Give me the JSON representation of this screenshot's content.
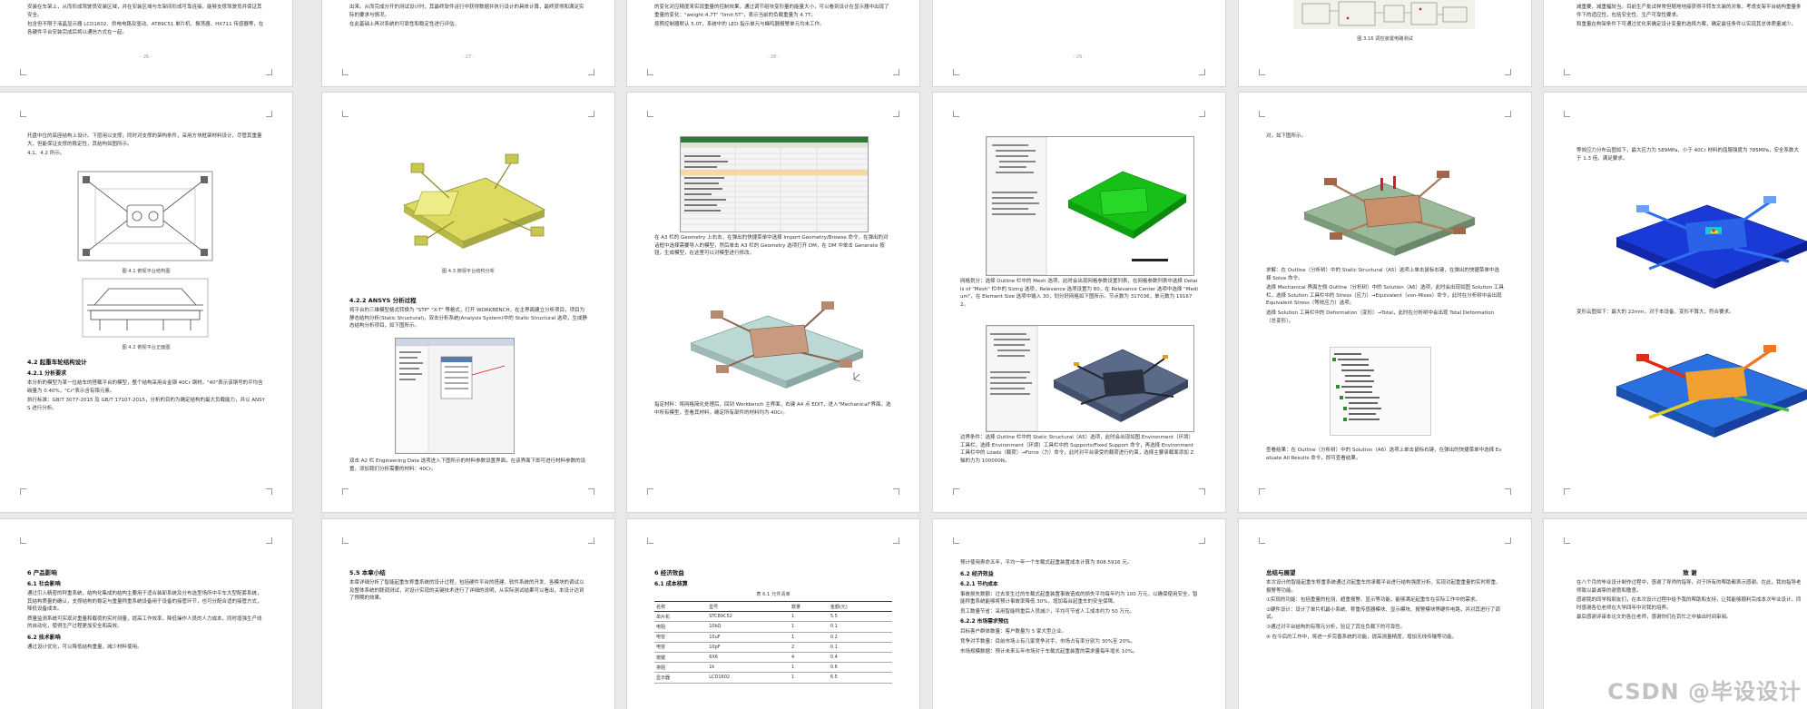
{
  "top_row": [
    {
      "page_number": "- 26 -",
      "lines": [
        "安装在车架上，从而形成驾驶员安装区域，并在安装区域与车架间形成可靠连接，能够支撑驾驶员并保证其安全。",
        "包含但不限于液晶显示器 LCD1602、供电电路及驱动、AT89C51 单片机、振荡器、HX711 传感器等，在各硬件平台安装完成后将以通信方式在一起。"
      ]
    },
    {
      "page_number": "- 27 -",
      "lines": [
        "出来。从而完成分开的测试设计时，其最终软件运行中获得数据并执行设计的具体计算，最终获得和满足实际的要求与情况。",
        "在此基础上再对系统的可靠性和稳定性进行评估。"
      ]
    },
    {
      "page_number": "- 28 -",
      "lines": [
        "的变化对应精度来实现重量的控制效果，通过调节组块变形量的能量大小，可以看到设计在显示器中出现了重量的变化：\"weight:4.7T\" \"limit:5T\"，表示当前的负载重量为 4.7T。",
        "按照控制器默认 5.0T，系统中的 LED 指示单元与蜂鸣器报警单元均未工作。"
      ]
    },
    {
      "page_number": "- 29 -",
      "lines": []
    },
    {
      "page_number": "",
      "lines": [],
      "caption": "图 3.16 调控装置电路测试"
    },
    {
      "page_number": "",
      "lines": [
        "减重要，减重幅较当。目前生产批试样常但随地地接获得平转车文装的对象，考虑支架平台结构重量条件下的适应性，包括安全性、生产可靠性要求。",
        "和重量在构架条件下可通过优化来确定设计变量的选择方案，确定最佳条件以实现其总体质量减少。"
      ]
    }
  ],
  "mid_row": [
    {
      "page_number": "- 30 -",
      "lines_top": [
        "托盘中位的底座结构上设计。下层用以支撑，同时对支撑的架构条件，采用方块框架材料设计，尽管其重量大，但能保证支撑的稳定性，其结构如图所示。",
        "4.1、4.2 所示。"
      ],
      "caption1": "图 4.1 俯视平台结构图",
      "caption2": "图 4.2 俯视平台正面图",
      "h1": "4.2 起重车轮结构设计",
      "h2": "4.2.1 分析要求",
      "lines_bottom": [
        "本分析的模型为某一位结车的搭载平台的模型，整个结构采用合金钢 40Cr 钢材。\"40\"表示该钢号的平均含碳量为 0.40%，\"Cr\"表示含有铬元素。",
        "执行标准：GB/T 3077-2015 及 GB/T 17107-2015，分析的目的为确定结构的最大负载能力，并以 ANSYS 进行分析。"
      ]
    },
    {
      "page_number": "- 31 -",
      "caption1": "图 4.3 俯视平台结构分析",
      "h1": "4.2.2 ANSYS 分析过程",
      "lines": [
        "将平台的三维模型格式转换为 \"STP\" \"X-T\" 等格式，打开 WORKBENCH，在主界面建立分析项目，项目为静态结构分析(Static Structural)，双击分析系统(Analysis System)中的 Static Structural 选项，生成静态结构分析项目，如下图所示。"
      ],
      "lines_bottom": [
        "双击 A2 栏 Engineering Data 选项进入下图所示的材料参数设置界面，在该界面下即可进行材料参数的设置，添加我们分析需要的材料：40Cr。"
      ]
    },
    {
      "page_number": "- 32 -",
      "lines": [
        "在 A3 栏的 Geometry 上右击，在弹出的快捷菜单中选择 Import Geometry/Browse 命令，在弹出的对话框中选择需要导入的模型，然后单击 A3 栏的 Geometry 选项打开 DM，在 DM 中单击 Generate 按钮，生成模型，在这里可以对模型进行修改。"
      ],
      "lines_bottom": [
        "指定材料：将网格简化处理后，回到 Workbench 主界面，右键 A4 点 EDIT，进入\"Mechanical\"界面。选中所有模型，查看其材料，确定所有部件的材料均为 40Cr。"
      ]
    },
    {
      "page_number": "- 33 -",
      "lines": [
        "网格划分：选择 Outline 栏中的 Mesh 选项，此时会出现网格参数设置列表，在网格参数列表中选择 Details of \"Mesh\" 栏中的 Sizing 选项，Relevance 选项设置为 80，在 Relevance Center 选项中选择 \"Medium\"，在 Element Size 选项中输入 30，划分好网格如下图所示。节点数为 317036，单元数为 191672。"
      ],
      "lines_bottom": [
        "边界条件：选择 Outline 栏中的 Static Structural（A5）选项，此时会出现如图 Environment（环境）工具栏，选择 Environment（环境）工具栏中的 Supports/Fixed Support 命令，再选择 Environment 工具栏中的 Loads（载荷）→Force（力）命令，此时对平台承受的载荷进行约束，选择主要承载面添加 Z 轴的力为 100000N。"
      ]
    },
    {
      "page_number": "- 34 -",
      "lines": [
        "对，如下图所示。"
      ],
      "lines_mid": [
        "求解：在 Outline（分析树）中的 Static Structural（A5）选项上单击鼠标右键，在弹出的快捷菜单中选择 Solve 命令。",
        "选择 Mechanical 界面左侧 Outline（分析树）中的 Solution（A6）选项，此时会出现如图 Solution 工具栏，选择 Solution 工具栏中的 Stress（应力）→Equivalent（von-Mises）命令，此时在分析树中会出现 Equivalent Stress（等效应力）选项。",
        "选择 Solution 工具栏中的 Deformation（变形）→Total，此时在分析树中会出现 Total Deformation（总变形）。"
      ],
      "lines_bottom": [
        "查看结果：在 Outline（分析树）中的 Solution（A6）选项上单击鼠标右键，在弹出的快捷菜单中选择 Evaluate All Results 命令，即可查看结果。"
      ]
    },
    {
      "page_number": "- 35 -",
      "lines": [
        "等效应力分布云图如下，最大应力为 589MPa，小于 40Cr 材料的屈服强度为 785MPa，安全系数大于 1.3 倍，满足要求。"
      ],
      "lines_mid": [
        "变形云图如下：最大的 22mm，对于本设备，变形不算大，符合要求。"
      ]
    }
  ],
  "bottom_row": [
    {
      "h1": "6 产品影响",
      "h2": "6.1 社会影响",
      "lines": [
        "通过引入精密的秤重系统，结构化集成的结构主要用于适合装卸系统及分布选型场所中平车大型配套系统，其结构质量的确认，支撑结构的稳定与重量称重系统设备用于设备的接管环节，也可分配合适的接管方式，降低设备成本。",
        "质量监测系统可实现对重量和载荷的实时测量，提高工作效率，降低操作人员的人力成本，同时增强生产线的自动化，使得生产过程更加安全和高效。"
      ],
      "h3": "6.2 技术影响",
      "lines_bottom": [
        "通过设计优化，可以降低结构重量，减少材料使用。"
      ]
    },
    {
      "h1": "5.5 本章小结",
      "lines": [
        "本章详细分析了智能起重车称重系统的设计过程，包括硬件平台的搭建、软件系统的开发、各模块的调试以及整体系统的联调测试，对设计实现的关键技术进行了详细的说明，从实际测试结果可以看出，本设计达到了预期的效果。"
      ]
    },
    {
      "h1": "6 经济效益",
      "h2": "6.1 成本核算",
      "table_caption": "表 6.1 元件清单",
      "columns": [
        "名称",
        "型号",
        "数量",
        "金额(元)"
      ],
      "rows": [
        [
          "单片机",
          "STC89C52",
          "1",
          "5.5"
        ],
        [
          "电阻",
          "10kΩ",
          "1",
          "0.1"
        ],
        [
          "电容",
          "10uF",
          "1",
          "0.2"
        ],
        [
          "电容",
          "10pF",
          "2",
          "0.1"
        ],
        [
          "按键",
          "6X6",
          "4",
          "0.4"
        ],
        [
          "排阻",
          "1k",
          "1",
          "0.6"
        ],
        [
          "显示器",
          "LCD1602",
          "1",
          "6.5"
        ]
      ]
    },
    {
      "lines_top": [
        "预计使用寿命五年，平均一年一个车载式起重装置成本计算为 808.5916 元。"
      ],
      "h1": "6.2 经济效益",
      "h2": "6.2.1 节约成本",
      "lines": [
        "事故损失数额：过去发生过的车载式起重装置事故造成的损失平均每年约为 100 万元，以确保使用安全，智能称重系统能够将预计事故率降低 30%，增加每台起重车的安全保障。",
        "员工数量节省：采用智能称重后人员减少，平均可节省人工成本约为 50 万元。"
      ],
      "h3": "6.2.2 市场需求预估",
      "lines_bottom": [
        "目标客户群体数量：客户数量为 5 家大型企业。",
        "竞争对手数量：目前市场上有几家竞争对手，市场占有率分别为 30%至 20%。",
        "市场规模数据：预计未来五年市场对于车载式起重装置的需求量每年增长 10%。"
      ]
    },
    {
      "h1": "总结与展望",
      "lines": [
        "本次设计的智能起重车称重系统通过对起重车的承载平台进行结构强度分析，实现对起重重量的实时称重、报警等功能。",
        "①实现的功能：包括重量的检测、超重报警、显示等功能，能够满足起重车在实际工作中的需求。",
        "②硬件设计：设计了单片机最小系统、称重传感器模块、显示模块、报警模块等硬件电路，并对其进行了调试。",
        "③通过对平台结构的有限元分析，验证了其在负载下的可靠性。",
        "④ 在今后的工作中，将进一步完善系统的功能，提高测量精度，增加无线传输等功能。"
      ]
    },
    {
      "h1": "致 谢",
      "lines": [
        "在八个月的毕业设计制作过程中，感谢了导师的指导，对于所有的帮助都表示感谢。在此，我向指导老师致以最诚挚的谢意和敬意。",
        "感谢我的同学和朋友们，在本次设计过程中给予我的帮助和支持，让我能够顺利完成本次毕业设计。同时感谢各位老师在大学四年中对我的培养。",
        "最后感谢评审本论文的各位老师，感谢你们在百忙之中抽出时间审阅。"
      ]
    }
  ],
  "watermark": "CSDN @毕设设计",
  "colors": {
    "stress_red": "#e12a1a",
    "stress_blue": "#1a3ad8",
    "mesh_green": "#18c018",
    "model_yellow": "#e9e86a",
    "model_copper": "#c09070"
  }
}
